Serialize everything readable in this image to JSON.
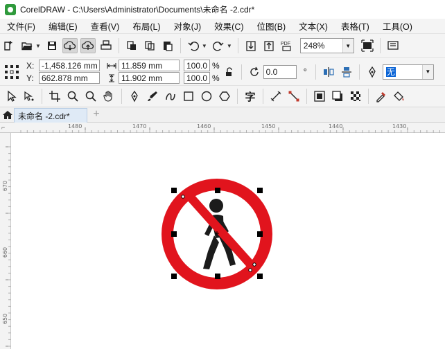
{
  "window": {
    "title": "CorelDRAW - C:\\Users\\Administrator\\Documents\\未命名 -2.cdr*"
  },
  "menu": [
    "文件(F)",
    "编辑(E)",
    "查看(V)",
    "布局(L)",
    "对象(J)",
    "效果(C)",
    "位图(B)",
    "文本(X)",
    "表格(T)",
    "工具(O)"
  ],
  "standard_toolbar": {
    "zoom_level": "248%"
  },
  "property_bar": {
    "x_label": "X:",
    "x_value": "-1,458.126 mm",
    "y_label": "Y:",
    "y_value": "662.878 mm",
    "width_value": "11.859 mm",
    "height_value": "11.902 mm",
    "scale_x": "100.0",
    "scale_y": "100.0",
    "percent": "%",
    "rotation": "0.0",
    "degree_symbol": "°",
    "outline_value": "无"
  },
  "document_tab": {
    "label": "未命名 -2.cdr*",
    "add_symbol": "+"
  },
  "ruler": {
    "h_labels": [
      "1480",
      "1470",
      "1460",
      "1450",
      "1440",
      "1430"
    ],
    "v_labels": [
      "670",
      "660",
      "650"
    ],
    "unit": "毫米"
  },
  "colors": {
    "sign_red": "#e1141d",
    "figure": "#1b1b1b",
    "ui_bg": "#f4f4f4",
    "tab_active": "#dfeaf6"
  },
  "canvas": {
    "object": "no-pedestrian-sign",
    "selection_handles": true
  }
}
